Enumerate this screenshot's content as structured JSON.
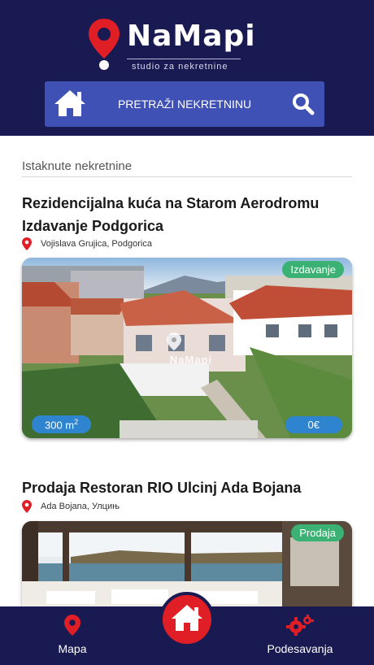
{
  "header": {
    "logo_name": "NaMapi",
    "logo_subtitle": "studio za nekretnine",
    "search_label": "PRETRAŽI NEKRETNINU",
    "icons": [
      "home-icon",
      "search-icon",
      "map-pin-icon"
    ]
  },
  "section": {
    "title": "Istaknute nekretnine"
  },
  "listings": [
    {
      "title_line1": "Rezidencijalna kuća na Starom Aerodromu",
      "title_line2": "Izdavanje Podgorica",
      "location": "Vojislava Grujica, Podgorica",
      "type": "Izdavanje",
      "area_value": "300 m",
      "area_unit_sup": "2",
      "price": "0€",
      "watermark": "NaMapi"
    },
    {
      "title_line1": "Prodaja Restoran RIO Ulcinj Ada Bojana",
      "location": "Ada Bojana, Улцињ",
      "type": "Prodaja"
    }
  ],
  "bottom_nav": {
    "map_label": "Mapa",
    "settings_label": "Podesavanja",
    "icons": [
      "map-pin-icon",
      "home-icon",
      "gears-icon"
    ]
  },
  "colors": {
    "navy": "#1a1a52",
    "search_blue": "#3f51b5",
    "accent_red": "#e01e26",
    "badge_green": "#3bb273",
    "badge_blue": "#2f84d0"
  }
}
